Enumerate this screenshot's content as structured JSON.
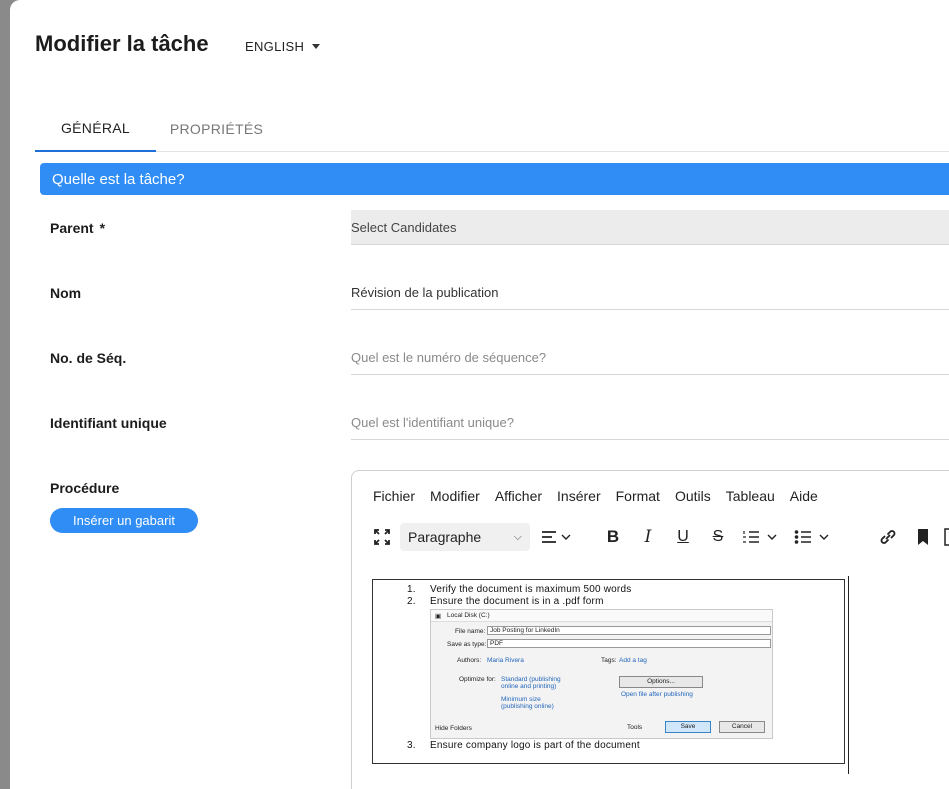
{
  "header": {
    "title": "Modifier la tâche",
    "language": "ENGLISH"
  },
  "tabs": [
    {
      "label": "GÉNÉRAL",
      "active": true
    },
    {
      "label": "PROPRIÉTÉS",
      "active": false
    }
  ],
  "section": {
    "title": "Quelle est la tâche?"
  },
  "form": {
    "parent": {
      "label": "Parent",
      "required_mark": "*",
      "value": "Select Candidates"
    },
    "nom": {
      "label": "Nom",
      "value": "Révision de la publication"
    },
    "seq": {
      "label": "No. de Séq.",
      "placeholder": "Quel est le numéro de séquence?"
    },
    "uid": {
      "label": "Identifiant unique",
      "placeholder": "Quel est l'identifiant unique?"
    },
    "procedure": {
      "label": "Procédure",
      "template_button": "Insérer un gabarit"
    }
  },
  "editor": {
    "menu": [
      "Fichier",
      "Modifier",
      "Afficher",
      "Insérer",
      "Format",
      "Outils",
      "Tableau",
      "Aide"
    ],
    "block_format": "Paragraphe",
    "toolbar_icons": [
      "fullscreen-icon",
      "align-left-icon",
      "bold-icon",
      "italic-icon",
      "underline-icon",
      "strikethrough-icon",
      "numbered-list-icon",
      "bullet-list-icon",
      "link-icon",
      "bookmark-icon"
    ],
    "list": [
      {
        "num": "1.",
        "text": "Verify the document is maximum 500 words"
      },
      {
        "num": "2.",
        "text": "Ensure the document is in a .pdf form"
      },
      {
        "num": "3.",
        "text": "Ensure company logo is part of the document"
      }
    ],
    "embedded_dialog": {
      "location": "Local Disk (C:)",
      "file_name_label": "File name:",
      "file_name": "Job Posting for LinkedIn",
      "save_type_label": "Save as type:",
      "save_type": "PDF",
      "authors_label": "Authors:",
      "authors": "Maria Rivera",
      "tags_label": "Tags:",
      "tags": "Add a tag",
      "optimize_label": "Optimize for:",
      "opt_standard": "Standard (publishing online and printing)",
      "opt_min": "Minimum size (publishing online)",
      "options_button": "Options...",
      "open_after": "Open file after publishing",
      "hide_folders": "Hide Folders",
      "tools": "Tools",
      "save": "Save",
      "cancel": "Cancel"
    }
  },
  "colors": {
    "accent": "#2f8df5",
    "tab_underline": "#1e6fd9"
  }
}
